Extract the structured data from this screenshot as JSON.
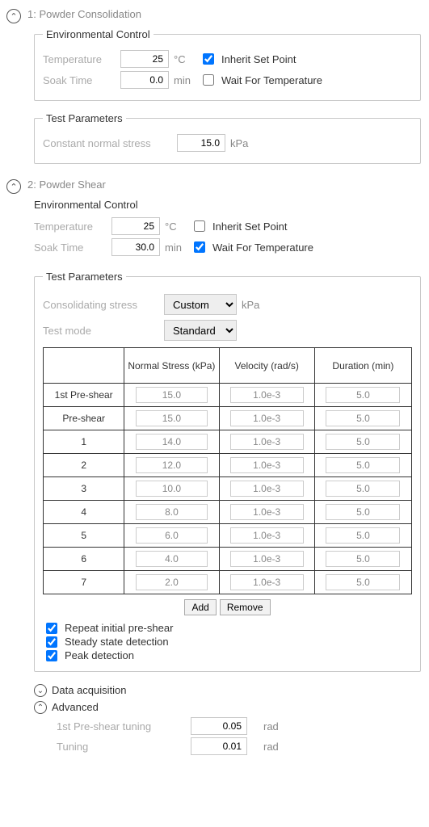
{
  "step1": {
    "title": "1: Powder Consolidation",
    "env": {
      "legend": "Environmental Control",
      "tempLabel": "Temperature",
      "tempVal": "25",
      "tempUnit": "°C",
      "inheritLabel": "Inherit Set Point",
      "soakLabel": "Soak Time",
      "soakVal": "0.0",
      "soakUnit": "min",
      "waitLabel": "Wait For Temperature"
    },
    "tp": {
      "legend": "Test Parameters",
      "cnsLabel": "Constant normal stress",
      "cnsVal": "15.0",
      "cnsUnit": "kPa"
    }
  },
  "step2": {
    "title": "2: Powder Shear",
    "env": {
      "legend": "Environmental Control",
      "tempLabel": "Temperature",
      "tempVal": "25",
      "tempUnit": "°C",
      "inheritLabel": "Inherit Set Point",
      "soakLabel": "Soak Time",
      "soakVal": "30.0",
      "soakUnit": "min",
      "waitLabel": "Wait For Temperature"
    },
    "tp": {
      "legend": "Test Parameters",
      "consLabel": "Consolidating stress",
      "consVal": "Custom",
      "consUnit": "kPa",
      "modeLabel": "Test mode",
      "modeVal": "Standard",
      "headers": {
        "c0": "",
        "c1": "Normal Stress (kPa)",
        "c2": "Velocity (rad/s)",
        "c3": "Duration (min)"
      },
      "rows": [
        {
          "name": "1st Pre-shear",
          "ns": "15.0",
          "v": "1.0e-3",
          "d": "5.0"
        },
        {
          "name": "Pre-shear",
          "ns": "15.0",
          "v": "1.0e-3",
          "d": "5.0"
        },
        {
          "name": "1",
          "ns": "14.0",
          "v": "1.0e-3",
          "d": "5.0"
        },
        {
          "name": "2",
          "ns": "12.0",
          "v": "1.0e-3",
          "d": "5.0"
        },
        {
          "name": "3",
          "ns": "10.0",
          "v": "1.0e-3",
          "d": "5.0"
        },
        {
          "name": "4",
          "ns": "8.0",
          "v": "1.0e-3",
          "d": "5.0"
        },
        {
          "name": "5",
          "ns": "6.0",
          "v": "1.0e-3",
          "d": "5.0"
        },
        {
          "name": "6",
          "ns": "4.0",
          "v": "1.0e-3",
          "d": "5.0"
        },
        {
          "name": "7",
          "ns": "2.0",
          "v": "1.0e-3",
          "d": "5.0"
        }
      ],
      "addLabel": "Add",
      "removeLabel": "Remove",
      "repeatLabel": "Repeat initial pre-shear",
      "steadyLabel": "Steady state detection",
      "peakLabel": "Peak detection"
    },
    "daq": {
      "title": "Data acquisition"
    },
    "adv": {
      "title": "Advanced",
      "r1Label": "1st Pre-shear tuning",
      "r1Val": "0.05",
      "r1Unit": "rad",
      "r2Label": "Tuning",
      "r2Val": "0.01",
      "r2Unit": "rad"
    }
  }
}
